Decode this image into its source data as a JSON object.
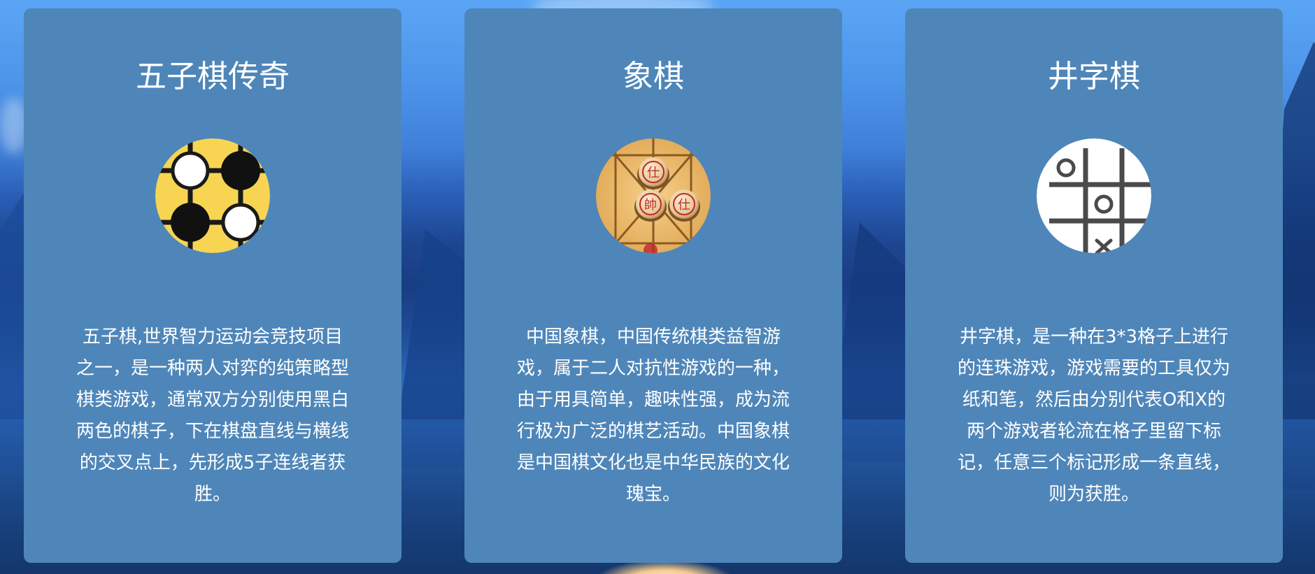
{
  "cards": [
    {
      "title": "五子棋传奇",
      "icon": "gomoku-board-icon",
      "description": "五子棋,世界智力运动会竞技项目之一，是一种两人对弈的纯策略型棋类游戏，通常双方分别使用黑白两色的棋子，下在棋盘直线与横线的交叉点上，先形成5子连线者获胜。"
    },
    {
      "title": "象棋",
      "icon": "chinese-chess-icon",
      "description": "中国象棋，中国传统棋类益智游戏，属于二人对抗性游戏的一种，由于用具简单，趣味性强，成为流行极为广泛的棋艺活动。中国象棋是中国棋文化也是中华民族的文化瑰宝。"
    },
    {
      "title": "井字棋",
      "icon": "tic-tac-toe-icon",
      "description": "井字棋，是一种在3*3格子上进行的连珠游戏，游戏需要的工具仅为纸和笔，然后由分别代表O和X的两个游戏者轮流在格子里留下标记，任意三个标记形成一条直线，则为获胜。"
    }
  ],
  "chess_pieces": [
    "仕",
    "帥",
    "仕"
  ],
  "colors": {
    "card_background": "#4f86b9",
    "gomoku_board": "#f7d553",
    "chess_board": "#e9b865",
    "piece_red": "#c0282a"
  }
}
